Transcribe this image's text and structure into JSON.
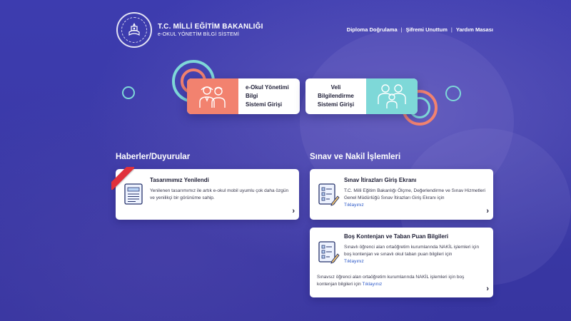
{
  "header": {
    "title": "T.C. MİLLİ EĞİTİM BAKANLIĞI",
    "subtitle": "e-OKUL YÖNETİM BİLGİ SİSTEMİ",
    "links": [
      "Diploma Doğrulama",
      "Şifremi Unuttum",
      "Yardım Masası"
    ],
    "separator": "|"
  },
  "login": {
    "eokul_line1": "e-Okul Yönetimi Bilgi",
    "eokul_line2": "Sistemi Girişi",
    "veli_line1": "Veli Bilgilendirme",
    "veli_line2": "Sistemi Girişi"
  },
  "news": {
    "section_title": "Haberler/Duyurular",
    "item_title": "Tasarımımız Yenilendi",
    "item_text": "Yenilenen tasarımımız ile artık e-okul mobil uyumlu çok daha özgün ve yenilikçi bir görünüme sahip."
  },
  "exam": {
    "section_title": "Sınav ve Nakil İşlemleri",
    "card1_title": "Sınav İtirazları Giriş Ekranı",
    "card1_text": "T.C. Milli Eğitim Bakanlığı Ölçme, Değerlendirme ve Sınav Hizmetleri Genel Müdürlüğü Sınav İtirazları Giriş Ekranı için",
    "card1_link": "Tıklayınız",
    "card2_title": "Boş Kontenjan ve Taban Puan Bilgileri",
    "card2_text": "Sınavlı öğrenci alan ortaöğretim kurumlarında NAKİL işlemleri için boş kontenjan ve sınavlı okul taban puan bilgileri için",
    "card2_link": "Tıklayınız",
    "card2_text2": "Sınavsız öğrenci alan ortaöğretim kurumlarında NAKİL işlemleri için boş kontenjan bilgileri için",
    "card2_link2": "Tıklayınız"
  },
  "chevron": "›",
  "colors": {
    "background": "#3b3aa8",
    "eokul_accent": "#f2826f",
    "veli_accent": "#7ed8d8",
    "link": "#2a57c8",
    "ribbon": "#e0313c"
  },
  "icons": [
    "meb-logo",
    "teachers-icon",
    "family-icon",
    "newspaper-icon",
    "checklist-icon",
    "chevron-right-icon"
  ]
}
